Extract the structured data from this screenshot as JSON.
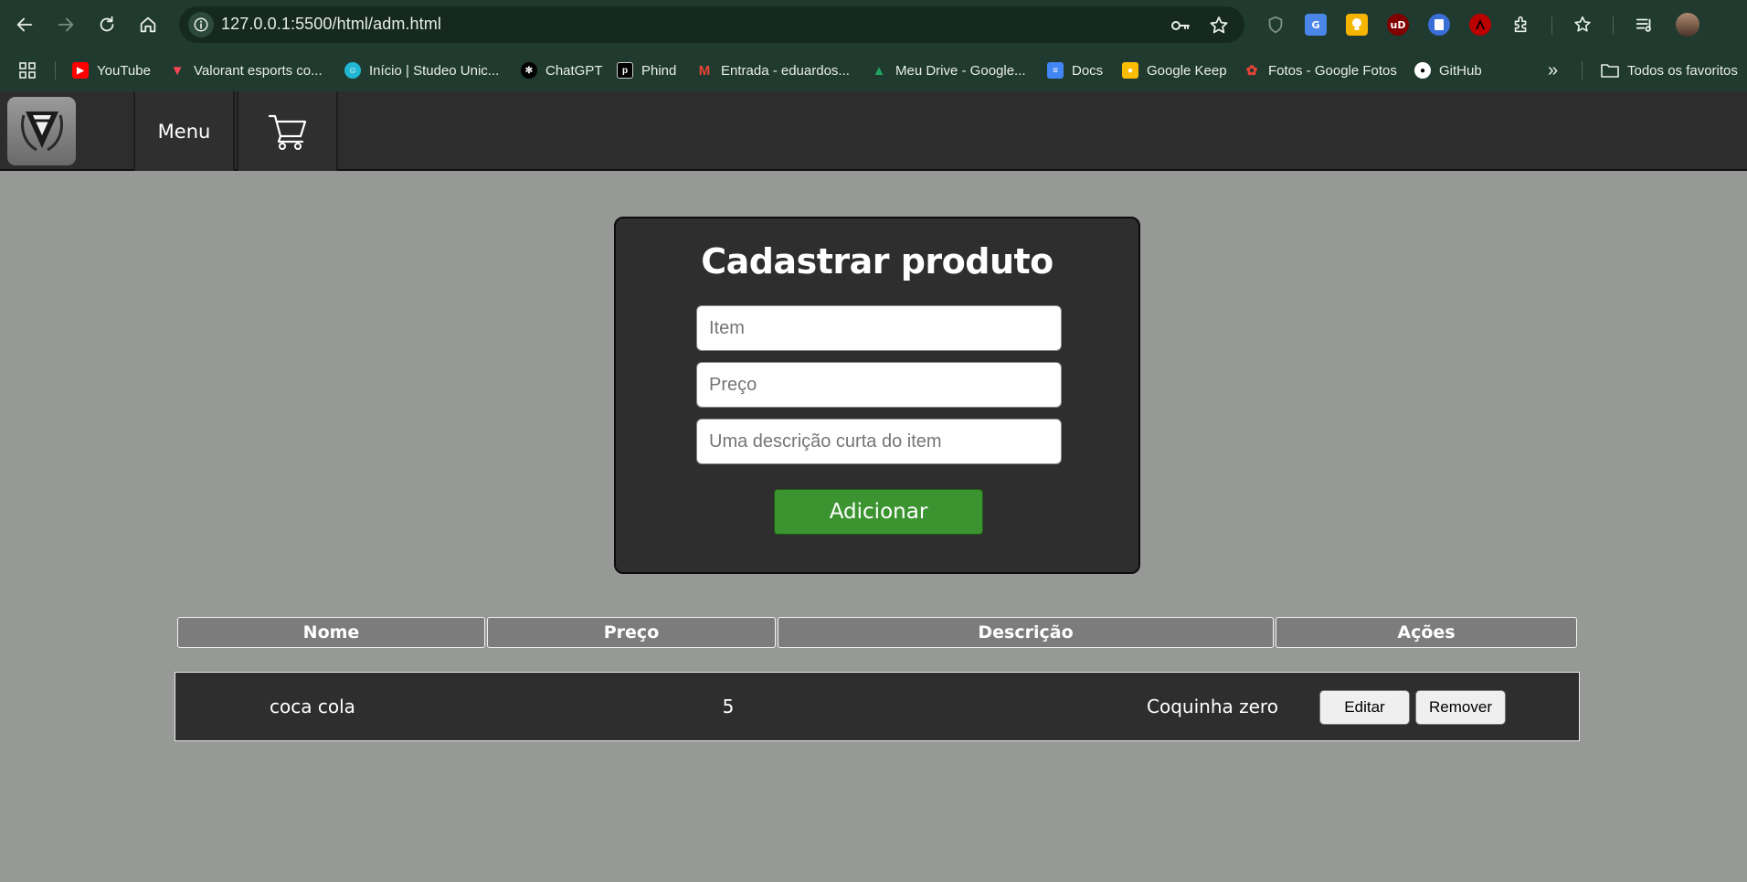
{
  "browser": {
    "url": "127.0.0.1:5500/html/adm.html",
    "bookmarks": [
      {
        "label": "YouTube",
        "icon": "youtube-icon",
        "color": "#ff0000"
      },
      {
        "label": "Valorant esports co...",
        "icon": "valorant-icon",
        "color": "#ff4655"
      },
      {
        "label": "Início | Studeo Unic...",
        "icon": "studeo-icon",
        "color": "#21b6d2"
      },
      {
        "label": "ChatGPT",
        "icon": "chatgpt-icon",
        "color": "#000000"
      },
      {
        "label": "Phind",
        "icon": "phind-icon",
        "color": "#000000"
      },
      {
        "label": "Entrada - eduardos...",
        "icon": "gmail-icon",
        "color": "#ea4335"
      },
      {
        "label": "Meu Drive - Google...",
        "icon": "google-drive-icon",
        "color": "#1fa463"
      },
      {
        "label": "Docs",
        "icon": "google-docs-icon",
        "color": "#4285f4"
      },
      {
        "label": "Google Keep",
        "icon": "google-keep-icon",
        "color": "#fbbc04"
      },
      {
        "label": "Fotos - Google Fotos",
        "icon": "google-photos-icon",
        "color": "#ea4335"
      },
      {
        "label": "GitHub",
        "icon": "github-icon",
        "color": "#ffffff"
      }
    ],
    "overflow_label": "»",
    "all_bookmarks_label": "Todos os favoritos"
  },
  "header": {
    "menu_label": "Menu"
  },
  "form": {
    "title": "Cadastrar produto",
    "item_placeholder": "Item",
    "price_placeholder": "Preço",
    "description_placeholder": "Uma descrição curta do item",
    "submit_label": "Adicionar",
    "submit_color": "#3c9430"
  },
  "table": {
    "columns": [
      "Nome",
      "Preço",
      "Descrição",
      "Ações"
    ],
    "rows": [
      {
        "nome": "coca cola",
        "preco": "5",
        "descricao": "Coquinha zero",
        "edit_label": "Editar",
        "remove_label": "Remover"
      }
    ]
  }
}
